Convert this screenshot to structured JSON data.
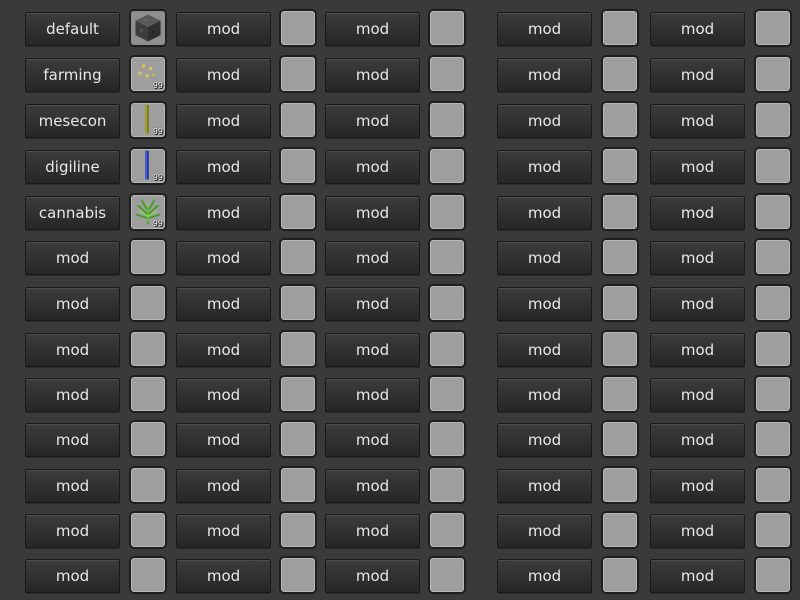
{
  "colors": {
    "background": "#3a3a3a",
    "button_text": "#e8e8e8",
    "slot_fill": "#9e9e9e"
  },
  "rows": [
    {
      "label": "default",
      "item": {
        "icon": "stone-block-icon",
        "count": ""
      }
    },
    {
      "label": "farming",
      "item": {
        "icon": "seeds-icon",
        "count": "99"
      }
    },
    {
      "label": "mesecon",
      "item": {
        "icon": "mesecon-wire-icon",
        "count": "99"
      }
    },
    {
      "label": "digiline",
      "item": {
        "icon": "digiline-wire-icon",
        "count": "99"
      }
    },
    {
      "label": "cannabis",
      "item": {
        "icon": "cannabis-plant-icon",
        "count": "99"
      }
    },
    {
      "label": "mod",
      "item": null
    },
    {
      "label": "mod",
      "item": null
    },
    {
      "label": "mod",
      "item": null
    },
    {
      "label": "mod",
      "item": null
    },
    {
      "label": "mod",
      "item": null
    },
    {
      "label": "mod",
      "item": null
    },
    {
      "label": "mod",
      "item": null
    },
    {
      "label": "mod",
      "item": null
    }
  ],
  "other_columns_label": "mod",
  "column_count": 5
}
